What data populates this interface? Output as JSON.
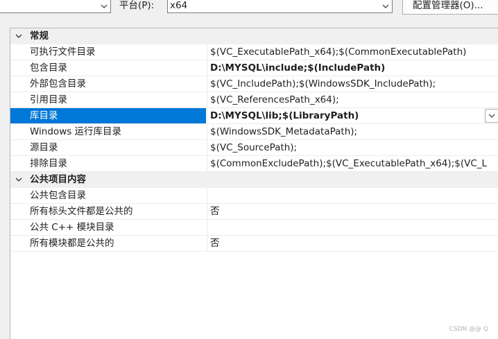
{
  "toolbar": {
    "platform_label": "平台(P):",
    "platform_value": "x64",
    "config_manager_label": "配置管理器(O)..."
  },
  "categories": [
    {
      "name": "常规",
      "rows": [
        {
          "name": "可执行文件目录",
          "value": "$(VC_ExecutablePath_x64);$(CommonExecutablePath)",
          "bold": false
        },
        {
          "name": "包含目录",
          "value": "D:\\MYSQL\\include;$(IncludePath)",
          "bold": true
        },
        {
          "name": "外部包含目录",
          "value": "$(VC_IncludePath);$(WindowsSDK_IncludePath);",
          "bold": false
        },
        {
          "name": "引用目录",
          "value": "$(VC_ReferencesPath_x64);",
          "bold": false
        },
        {
          "name": "库目录",
          "value": "D:\\MYSQL\\lib;$(LibraryPath)",
          "bold": true,
          "selected": true
        },
        {
          "name": "Windows 运行库目录",
          "value": "$(WindowsSDK_MetadataPath);",
          "bold": false
        },
        {
          "name": "源目录",
          "value": "$(VC_SourcePath);",
          "bold": false
        },
        {
          "name": "排除目录",
          "value": "$(CommonExcludePath);$(VC_ExecutablePath_x64);$(VC_L",
          "bold": false
        }
      ]
    },
    {
      "name": "公共项目内容",
      "rows": [
        {
          "name": "公共包含目录",
          "value": "",
          "bold": false
        },
        {
          "name": "所有标头文件都是公共的",
          "value": "否",
          "bold": false
        },
        {
          "name": "公共 C++ 模块目录",
          "value": "",
          "bold": false
        },
        {
          "name": "所有模块都是公共的",
          "value": "否",
          "bold": false
        }
      ]
    }
  ],
  "watermark": "CSDN @@ Q"
}
